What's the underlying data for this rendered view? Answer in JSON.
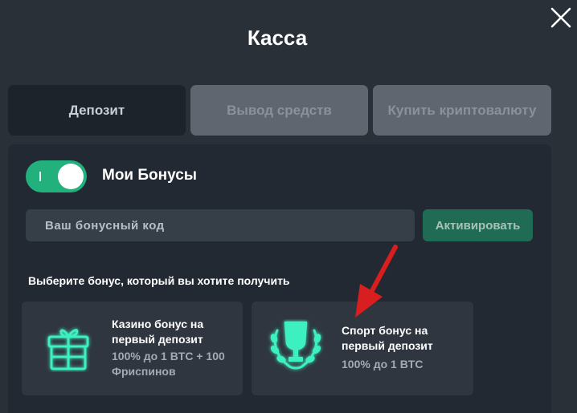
{
  "header": {
    "title": "Касса"
  },
  "tabs": [
    {
      "label": "Депозит",
      "active": true
    },
    {
      "label": "Вывод средств",
      "active": false
    },
    {
      "label": "Купить криптовалюту",
      "active": false
    }
  ],
  "bonuses": {
    "toggle_label": "Мои Бонусы",
    "toggle_on": true,
    "promo_placeholder": "Ваш бонусный код",
    "promo_value": "",
    "activate_label": "Активировать",
    "choose_label": "Выберите бонус, который вы хотите получить",
    "cards": [
      {
        "title": "Казино бонус на первый депозит",
        "desc": "100% до 1 BTC + 100 Фриспинов",
        "icon": "gift-icon"
      },
      {
        "title": "Спорт бонус на первый депозит",
        "desc": "100% до 1 BTC",
        "icon": "trophy-icon"
      }
    ]
  },
  "colors": {
    "accent": "#22b07d",
    "background": "#2a3038",
    "panel": "#222932",
    "icon_glow": "#3df0c0",
    "annotation_arrow": "#d81e1e"
  }
}
